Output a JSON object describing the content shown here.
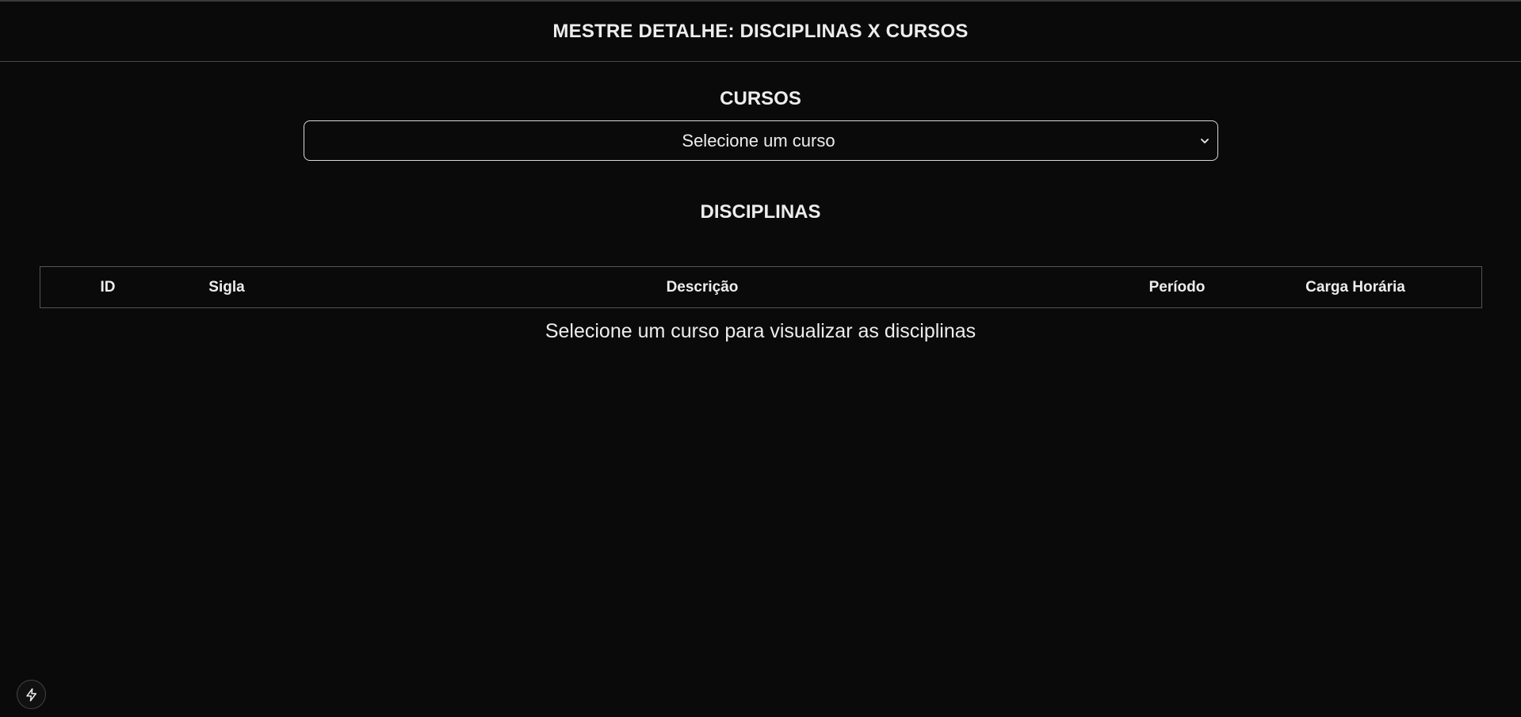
{
  "header": {
    "title": "MESTRE DETALHE: DISCIPLINAS X CURSOS"
  },
  "courses": {
    "title": "CURSOS",
    "select": {
      "selected": "Selecione um curso",
      "icon": "chevron-down-icon"
    }
  },
  "subjects": {
    "title": "DISCIPLINAS",
    "table": {
      "columns": [
        "ID",
        "Sigla",
        "Descrição",
        "Período",
        "Carga Horária"
      ]
    },
    "empty_message": "Selecione um curso para visualizar as disciplinas"
  },
  "dev_indicator": {
    "icon": "lightning-icon"
  },
  "colors": {
    "background": "#0a0a0a",
    "text": "#ededed",
    "border": "#d8d8d8"
  }
}
